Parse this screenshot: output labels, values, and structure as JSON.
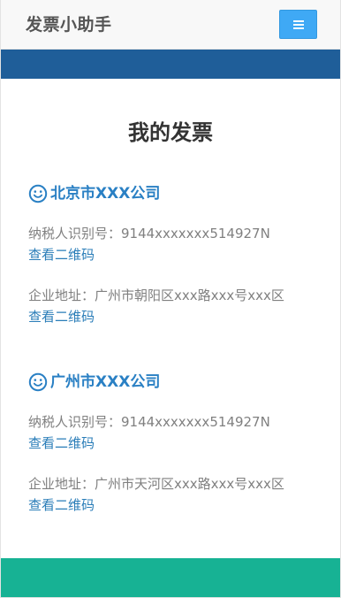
{
  "app": {
    "brand": "发票小助手"
  },
  "colors": {
    "header_band": "#1f5e99",
    "footer_band": "#17b294",
    "menu_button": "#3fa9f5",
    "company_name": "#2a80c4",
    "link": "#2a7db8"
  },
  "icons": {
    "menu": "hamburger-icon",
    "company": "smile-icon"
  },
  "main": {
    "title": "我的发票",
    "companies": [
      {
        "name": "北京市XXX公司",
        "tax_id": "纳税人识别号：9144xxxxxxx514927N",
        "tax_qr_link": "查看二维码",
        "address": "企业地址：广州市朝阳区xxx路xxx号xxx区",
        "address_qr_link": "查看二维码"
      },
      {
        "name": "广州市XXX公司",
        "tax_id": "纳税人识别号：9144xxxxxxx514927N",
        "tax_qr_link": "查看二维码",
        "address": "企业地址：广州市天河区xxx路xxx号xxx区",
        "address_qr_link": "查看二维码"
      }
    ]
  }
}
